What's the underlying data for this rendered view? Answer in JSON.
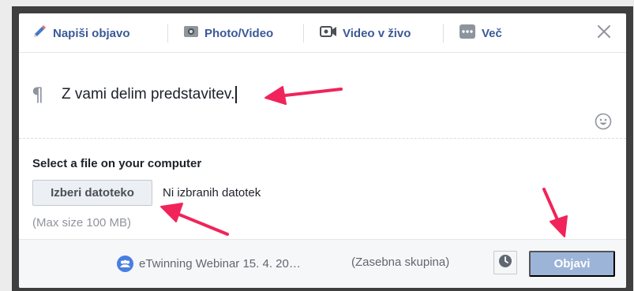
{
  "tabs": [
    {
      "label": "Napiši objavo",
      "icon": "pencil-icon"
    },
    {
      "label": "Photo/Video",
      "icon": "camera-icon"
    },
    {
      "label": "Video v živo",
      "icon": "video-camera-icon"
    },
    {
      "label": "Več",
      "icon": "more-icon"
    }
  ],
  "composer": {
    "pilcrow": "¶",
    "text": "Z vami delim predstavitev."
  },
  "upload": {
    "title": "Select a file on your computer",
    "button_label": "Izberi datoteko",
    "status": "Ni izbranih datotek",
    "max_size": "(Max size 100 MB)"
  },
  "footer": {
    "group": "eTwinning Webinar 15. 4. 20…",
    "privacy": "(Zasebna skupina)",
    "post_label": "Objavi"
  },
  "colors": {
    "brand": "#3b5998",
    "annotation_arrow": "#f0245a",
    "post_button": "#9cb4d8"
  }
}
